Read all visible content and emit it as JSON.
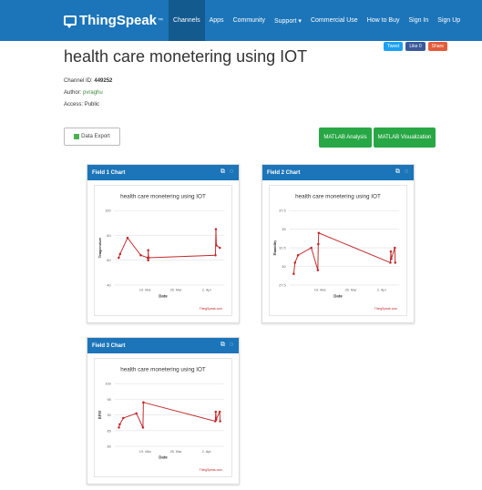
{
  "nav": {
    "brand": "ThingSpeak",
    "brand_tm": "™",
    "left_items": [
      "Channels",
      "Apps",
      "Community",
      "Support ▾"
    ],
    "right_items": [
      "Commercial Use",
      "How to Buy",
      "Sign In",
      "Sign Up"
    ]
  },
  "channel": {
    "title": "health care monetering using IOT",
    "id_label": "Channel ID:",
    "id_value": "449252",
    "author_label": "Author:",
    "author_value": "pvraghu",
    "access_label": "Access:",
    "access_value": "Public"
  },
  "share": {
    "tweet": "Tweet",
    "like": "Like 0",
    "share": "Share"
  },
  "buttons": {
    "export": "Data Export",
    "matlab_analysis": "MATLAB Analysis",
    "matlab_visualization": "MATLAB Visualization"
  },
  "panels": [
    {
      "header": "Field 1 Chart"
    },
    {
      "header": "Field 2 Chart"
    },
    {
      "header": "Field 3 Chart"
    }
  ],
  "colors": {
    "brand": "#1c75b9",
    "series": "#c0292b",
    "button_green": "#28a745"
  },
  "chart_data": [
    {
      "type": "line",
      "title": "health care monetering using IOT",
      "xlabel": "Date",
      "ylabel": "Temperature",
      "credit": "ThingSpeak.com",
      "ylim": [
        40,
        100
      ],
      "yticks": [
        "100",
        "80",
        "60",
        "40"
      ],
      "xticks": [
        {
          "label": "19. Mar",
          "x": 19
        },
        {
          "label": "26. Mar",
          "x": 26
        },
        {
          "label": "2. Apr",
          "x": 33
        }
      ],
      "xlim": [
        12,
        37
      ],
      "series": [
        {
          "values": [
            [
              13,
              62
            ],
            [
              13.3,
              65
            ],
            [
              15,
              78
            ],
            [
              18,
              64
            ],
            [
              19.6,
              62
            ],
            [
              19.7,
              60
            ],
            [
              19.7,
              68
            ],
            [
              19.8,
              62
            ],
            [
              35,
              64
            ],
            [
              35.1,
              85
            ],
            [
              35.2,
              72
            ],
            [
              36,
              70
            ]
          ]
        }
      ]
    },
    {
      "type": "line",
      "title": "health care monetering using IOT",
      "xlabel": "Date",
      "ylabel": "Humidity",
      "credit": "ThingSpeak.com",
      "ylim": [
        27.5,
        37.5
      ],
      "yticks": [
        "37.5",
        "35",
        "32.5",
        "30",
        "27.5"
      ],
      "xticks": [
        {
          "label": "19. Mar",
          "x": 19
        },
        {
          "label": "26. Mar",
          "x": 26
        },
        {
          "label": "2. Apr",
          "x": 33
        }
      ],
      "xlim": [
        12,
        37
      ],
      "series": [
        {
          "values": [
            [
              13,
              29
            ],
            [
              13.3,
              30.5
            ],
            [
              14,
              31.5
            ],
            [
              17,
              32.5
            ],
            [
              18.5,
              29.5
            ],
            [
              18.6,
              33
            ],
            [
              18.7,
              34.5
            ],
            [
              35,
              30.5
            ],
            [
              35.1,
              32
            ],
            [
              35.2,
              31
            ],
            [
              36,
              32.5
            ],
            [
              36.1,
              30.5
            ]
          ]
        }
      ]
    },
    {
      "type": "line",
      "title": "health care monetering using IOT",
      "xlabel": "Date",
      "ylabel": "BPM",
      "credit": "ThingSpeak.com",
      "ylim": [
        80,
        100
      ],
      "yticks": [
        "100",
        "95",
        "90",
        "85",
        "80"
      ],
      "xticks": [
        {
          "label": "19. Mar",
          "x": 19
        },
        {
          "label": "26. Mar",
          "x": 26
        },
        {
          "label": "2. Apr",
          "x": 33
        }
      ],
      "xlim": [
        12,
        37
      ],
      "series": [
        {
          "values": [
            [
              13,
              86
            ],
            [
              13.2,
              87
            ],
            [
              14,
              89
            ],
            [
              17,
              90.5
            ],
            [
              18.5,
              86
            ],
            [
              18.6,
              94
            ],
            [
              35,
              88
            ],
            [
              35.1,
              91
            ],
            [
              35.2,
              88.5
            ],
            [
              36,
              91
            ],
            [
              36.1,
              88
            ]
          ]
        }
      ]
    }
  ]
}
